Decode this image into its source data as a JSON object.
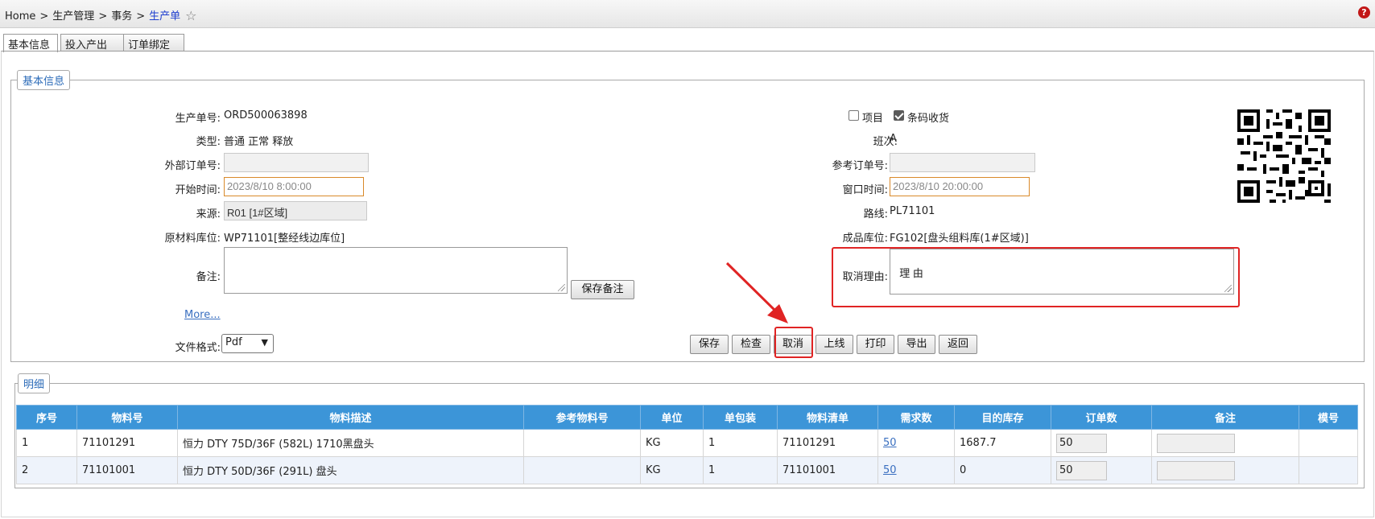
{
  "breadcrumb": {
    "home": "Home",
    "level1": "生产管理",
    "level2": "事务",
    "current": "生产单",
    "separator": ">"
  },
  "icons": {
    "star": "star-icon",
    "help": "help-icon",
    "qr": "qr-code-icon",
    "arrow": "red-arrow-annotation"
  },
  "help_glyph": "?",
  "tabs": [
    {
      "label": "基本信息"
    },
    {
      "label": "投入产出"
    },
    {
      "label": "订单绑定"
    }
  ],
  "basic": {
    "legend": "基本信息",
    "order_no": {
      "label": "生产单号:",
      "value": "ORD500063898"
    },
    "type": {
      "label": "类型:",
      "value": "普通 正常 释放"
    },
    "external_order": {
      "label": "外部订单号:",
      "value": ""
    },
    "start_time": {
      "label": "开始时间:",
      "value": "2023/8/10 8:00:00"
    },
    "source": {
      "label": "来源:",
      "value": "R01 [1#区域]"
    },
    "raw_location": {
      "label": "原材料库位:",
      "value": "WP71101[整经线边库位]"
    },
    "remark": {
      "label": "备注:",
      "value": ""
    },
    "save_remark_button": "保存备注",
    "more_link": "More...",
    "file_format": {
      "label": "文件格式:",
      "selected": "Pdf"
    },
    "project": {
      "label": "项目",
      "checked": false
    },
    "barcode_receive": {
      "label": "条码收货",
      "checked": true
    },
    "shift": {
      "label": "班次:",
      "value": "A"
    },
    "ref_order": {
      "label": "参考订单号:",
      "value": ""
    },
    "window_time": {
      "label": "窗口时间:",
      "value": "2023/8/10 20:00:00"
    },
    "route": {
      "label": "路线:",
      "value": "PL71101"
    },
    "finished_location": {
      "label": "成品库位:",
      "value": "FG102[盘头组料库(1#区域)]"
    },
    "cancel_reason": {
      "label": "取消理由:",
      "value": "理 由"
    }
  },
  "actions": [
    {
      "label": "保存",
      "name": "save-button"
    },
    {
      "label": "检查",
      "name": "check-button"
    },
    {
      "label": "取消",
      "name": "cancel-button"
    },
    {
      "label": "上线",
      "name": "online-button"
    },
    {
      "label": "打印",
      "name": "print-button"
    },
    {
      "label": "导出",
      "name": "export-button"
    },
    {
      "label": "返回",
      "name": "return-button"
    }
  ],
  "detail": {
    "legend": "明细",
    "columns": [
      "序号",
      "物料号",
      "物料描述",
      "参考物料号",
      "单位",
      "单包装",
      "物料清单",
      "需求数",
      "目的库存",
      "订单数",
      "备注",
      "模号"
    ],
    "rows": [
      {
        "seq": "1",
        "material": "71101291",
        "desc": "恒力 DTY 75D/36F (582L) 1710黑盘头",
        "ref": "",
        "unit": "KG",
        "pack": "1",
        "bom": "71101291",
        "demand": "50",
        "target_stock": "1687.7",
        "order_qty": "50",
        "remark": "",
        "mold": ""
      },
      {
        "seq": "2",
        "material": "71101001",
        "desc": "恒力 DTY 50D/36F (291L) 盘头",
        "ref": "",
        "unit": "KG",
        "pack": "1",
        "bom": "71101001",
        "demand": "50",
        "target_stock": "0",
        "order_qty": "50",
        "remark": "",
        "mold": ""
      }
    ]
  },
  "colors": {
    "header_blue": "#3c95d8",
    "legend_blue": "#2b6bb8",
    "annotation_red": "#e02424",
    "input_orange": "#d9892a"
  }
}
